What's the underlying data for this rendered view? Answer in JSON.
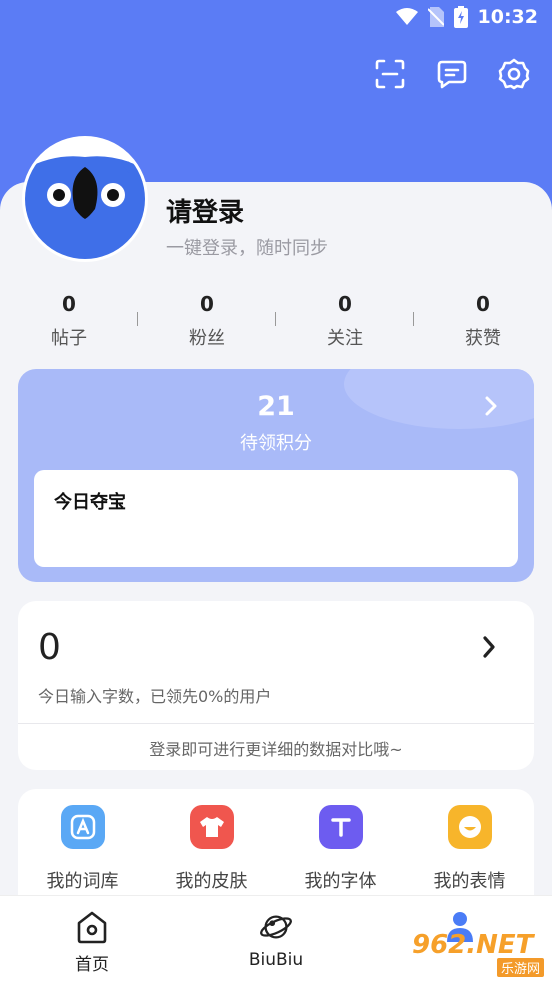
{
  "status_bar": {
    "time": "10:32"
  },
  "profile": {
    "title": "请登录",
    "subtitle": "一键登录，随时同步"
  },
  "stats": [
    {
      "value": "0",
      "label": "帖子"
    },
    {
      "value": "0",
      "label": "粉丝"
    },
    {
      "value": "0",
      "label": "关注"
    },
    {
      "value": "0",
      "label": "获赞"
    }
  ],
  "points": {
    "value": "21",
    "label": "待领积分",
    "treasure_title": "今日夺宝"
  },
  "input_stats": {
    "count": "0",
    "description": "今日输入字数，已领先0%的用户",
    "note": "登录即可进行更详细的数据对比哦~"
  },
  "tools": [
    {
      "label": "我的词库",
      "icon": "dictionary-icon",
      "color": "#5aa8f5",
      "glyph": "A"
    },
    {
      "label": "我的皮肤",
      "icon": "skin-icon",
      "color": "#f0564e",
      "glyph": ""
    },
    {
      "label": "我的字体",
      "icon": "font-icon",
      "color": "#6d5cf0",
      "glyph": "T"
    },
    {
      "label": "我的表情",
      "icon": "emoji-icon",
      "color": "#f7b52b",
      "glyph": ""
    }
  ],
  "bottom_nav": [
    {
      "label": "首页",
      "icon": "home-icon"
    },
    {
      "label": "BiuBiu",
      "icon": "planet-icon"
    },
    {
      "label": "",
      "icon": "profile-icon"
    }
  ],
  "watermark": {
    "main": "962.NET",
    "sub": "乐游网"
  },
  "colors": {
    "header": "#5b7cf5",
    "points_card": "#a9baf8"
  }
}
